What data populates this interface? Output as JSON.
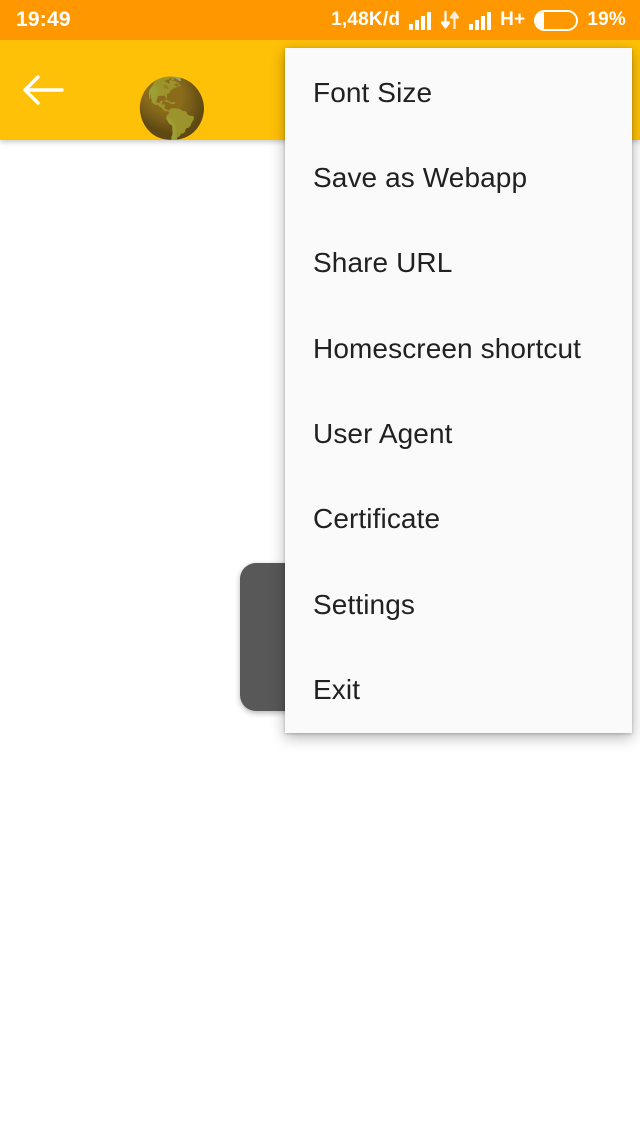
{
  "status_bar": {
    "clock": "19:49",
    "data_rate": "1,48K/d",
    "network_type": "H+",
    "battery_percent": "19%",
    "battery_level": 19,
    "icons": [
      "signal-bars-icon",
      "data-transfer-icon",
      "signal-bars-icon",
      "battery-icon"
    ],
    "background_color": "#FF9800",
    "foreground_color": "#FFFFFF"
  },
  "toolbar": {
    "back_icon": "back-arrow-icon",
    "favicon": "🌎",
    "favicon_name": "globe-earth-icon",
    "background_color": "#FFC107"
  },
  "toast": {
    "background_color": "#585858"
  },
  "overflow_menu": {
    "background_color": "#FAFAFA",
    "text_color": "#212121",
    "items": [
      {
        "label": "Font Size"
      },
      {
        "label": "Save as Webapp"
      },
      {
        "label": "Share URL"
      },
      {
        "label": "Homescreen shortcut"
      },
      {
        "label": "User Agent"
      },
      {
        "label": "Certificate"
      },
      {
        "label": "Settings"
      },
      {
        "label": "Exit"
      }
    ]
  },
  "page_content": {
    "background_color": "#FFFFFF"
  }
}
